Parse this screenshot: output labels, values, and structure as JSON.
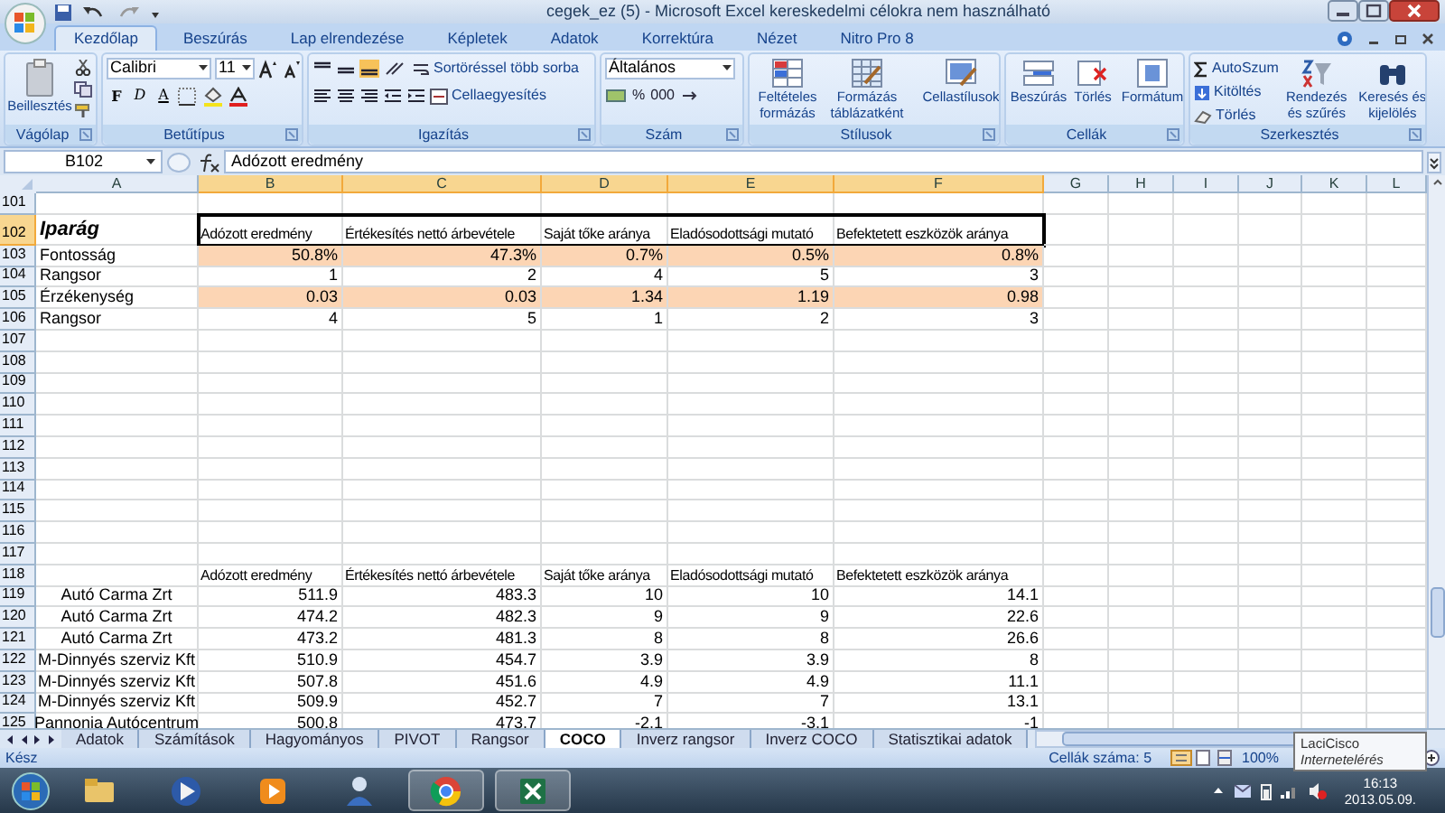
{
  "window": {
    "title": "cegek_ez (5) - Microsoft Excel kereskedelmi célokra nem használható"
  },
  "ribbon": {
    "tabs": [
      {
        "label": "Kezdőlap",
        "selected": true
      },
      {
        "label": "Beszúrás",
        "selected": false
      },
      {
        "label": "Lap elrendezése",
        "selected": false
      },
      {
        "label": "Képletek",
        "selected": false
      },
      {
        "label": "Adatok",
        "selected": false
      },
      {
        "label": "Korrektúra",
        "selected": false
      },
      {
        "label": "Nézet",
        "selected": false
      },
      {
        "label": "Nitro Pro 8",
        "selected": false
      }
    ],
    "groups": [
      {
        "label": "Vágólap",
        "buttons": [
          "Beillesztés"
        ]
      },
      {
        "label": "Betűtípus",
        "font": "Calibri",
        "size": "11",
        "buttons": [
          "F",
          "D",
          "A"
        ]
      },
      {
        "label": "Igazítás",
        "buttons": [
          "Sortöréssel több sorba",
          "Cellaegyesítés"
        ]
      },
      {
        "label": "Szám",
        "format": "Általános",
        "buttons": [
          "%",
          "000"
        ]
      },
      {
        "label": "Stílusok",
        "buttons": [
          "Feltételes formázás",
          "Formázás táblázatként",
          "Cellastílusok"
        ]
      },
      {
        "label": "Cellák",
        "buttons": [
          "Beszúrás",
          "Törlés",
          "Formátum"
        ]
      },
      {
        "label": "Szerkesztés",
        "buttons": [
          "AutoSzum",
          "Kitöltés",
          "Törlés",
          "Rendezés és szűrés",
          "Keresés és kijelölés"
        ]
      }
    ]
  },
  "formula_bar": {
    "name_box": "B102",
    "formula": "Adózott eredmény"
  },
  "columns": [
    {
      "label": "A",
      "selected": false
    },
    {
      "label": "B",
      "selected": true
    },
    {
      "label": "C",
      "selected": true
    },
    {
      "label": "D",
      "selected": true
    },
    {
      "label": "E",
      "selected": true
    },
    {
      "label": "F",
      "selected": true
    },
    {
      "label": "G",
      "selected": false
    },
    {
      "label": "H",
      "selected": false
    },
    {
      "label": "I",
      "selected": false
    },
    {
      "label": "J",
      "selected": false
    },
    {
      "label": "K",
      "selected": false
    },
    {
      "label": "L",
      "selected": false
    }
  ],
  "rows": [
    {
      "number": "101",
      "kind": "empty",
      "selected": false,
      "highlighted": false
    },
    {
      "number": "102",
      "kind": "header",
      "selected": true,
      "highlighted": false,
      "label": "Iparág",
      "cells": [
        "Adózott eredmény",
        "Értékesítés nettó árbevétele",
        "Saját tőke aránya",
        "Eladósodottsági mutató",
        "Befektetett eszközök aránya"
      ]
    },
    {
      "number": "103",
      "kind": "values",
      "selected": false,
      "highlighted": true,
      "label": "Fontosság",
      "cells": [
        "50.8%",
        "47.3%",
        "0.7%",
        "0.5%",
        "0.8%"
      ]
    },
    {
      "number": "104",
      "kind": "values",
      "selected": false,
      "highlighted": false,
      "label": "Rangsor",
      "cells": [
        "1",
        "2",
        "4",
        "5",
        "3"
      ]
    },
    {
      "number": "105",
      "kind": "values",
      "selected": false,
      "highlighted": true,
      "label": "Érzékenység",
      "cells": [
        "0.03",
        "0.03",
        "1.34",
        "1.19",
        "0.98"
      ]
    },
    {
      "number": "106",
      "kind": "values",
      "selected": false,
      "highlighted": false,
      "label": "Rangsor",
      "cells": [
        "4",
        "5",
        "1",
        "2",
        "3"
      ]
    },
    {
      "number": "107",
      "kind": "empty",
      "selected": false,
      "highlighted": false
    },
    {
      "number": "108",
      "kind": "empty",
      "selected": false,
      "highlighted": false
    },
    {
      "number": "109",
      "kind": "empty",
      "selected": false,
      "highlighted": false
    },
    {
      "number": "110",
      "kind": "empty",
      "selected": false,
      "highlighted": false
    },
    {
      "number": "111",
      "kind": "empty",
      "selected": false,
      "highlighted": false
    },
    {
      "number": "112",
      "kind": "empty",
      "selected": false,
      "highlighted": false
    },
    {
      "number": "113",
      "kind": "empty",
      "selected": false,
      "highlighted": false
    },
    {
      "number": "114",
      "kind": "empty",
      "selected": false,
      "highlighted": false
    },
    {
      "number": "115",
      "kind": "empty",
      "selected": false,
      "highlighted": false
    },
    {
      "number": "116",
      "kind": "empty",
      "selected": false,
      "highlighted": false
    },
    {
      "number": "117",
      "kind": "empty",
      "selected": false,
      "highlighted": false
    },
    {
      "number": "118",
      "kind": "header",
      "selected": false,
      "highlighted": false,
      "cells": [
        "Adózott eredmény",
        "Értékesítés nettó árbevétele",
        "Saját tőke aránya",
        "Eladósodottsági mutató",
        "Befektetett eszközök aránya"
      ]
    },
    {
      "number": "119",
      "kind": "entries",
      "selected": false,
      "highlighted": false,
      "label": "Autó Carma Zrt",
      "cells": [
        "511.9",
        "483.3",
        "10",
        "10",
        "14.1"
      ]
    },
    {
      "number": "120",
      "kind": "entries",
      "selected": false,
      "highlighted": false,
      "label": "Autó Carma Zrt",
      "cells": [
        "474.2",
        "482.3",
        "9",
        "9",
        "22.6"
      ]
    },
    {
      "number": "121",
      "kind": "entries",
      "selected": false,
      "highlighted": false,
      "label": "Autó Carma Zrt",
      "cells": [
        "473.2",
        "481.3",
        "8",
        "8",
        "26.6"
      ]
    },
    {
      "number": "122",
      "kind": "entries",
      "selected": false,
      "highlighted": false,
      "label": "M-Dinnyés szerviz Kft",
      "cells": [
        "510.9",
        "454.7",
        "3.9",
        "3.9",
        "8"
      ]
    },
    {
      "number": "123",
      "kind": "entries",
      "selected": false,
      "highlighted": false,
      "label": "M-Dinnyés szerviz Kft",
      "cells": [
        "507.8",
        "451.6",
        "4.9",
        "4.9",
        "11.1"
      ]
    },
    {
      "number": "124",
      "kind": "entries",
      "selected": false,
      "highlighted": false,
      "label": "M-Dinnyés szerviz Kft",
      "cells": [
        "509.9",
        "452.7",
        "7",
        "7",
        "13.1"
      ]
    },
    {
      "number": "125",
      "kind": "entries",
      "selected": false,
      "highlighted": false,
      "label": "Pannonia Autócentrum",
      "cells": [
        "500.8",
        "473.7",
        "-2.1",
        "-3.1",
        "-1"
      ]
    }
  ],
  "sheet_tabs": [
    {
      "label": "Adatok",
      "selected": false
    },
    {
      "label": "Számítások",
      "selected": false
    },
    {
      "label": "Hagyományos",
      "selected": false
    },
    {
      "label": "PIVOT",
      "selected": false
    },
    {
      "label": "Rangsor",
      "selected": false
    },
    {
      "label": "COCO",
      "selected": true
    },
    {
      "label": "Inverz rangsor",
      "selected": false
    },
    {
      "label": "Inverz COCO",
      "selected": false
    },
    {
      "label": "Statisztikai adatok",
      "selected": false
    }
  ],
  "status_bar": {
    "status": "Kész",
    "selection_count": "Cellák száma: 5",
    "zoom": "100%"
  },
  "tooltip": {
    "title": "LaciCisco",
    "subtitle": "Internetelérés"
  },
  "taskbar": {
    "apps": [
      {
        "kind": "folder",
        "running": false
      },
      {
        "kind": "media",
        "running": false
      },
      {
        "kind": "player",
        "running": false
      },
      {
        "kind": "user",
        "running": false
      },
      {
        "kind": "browser",
        "running": true
      },
      {
        "kind": "spreadsheet",
        "running": true
      }
    ],
    "time": "16:13",
    "date": "2013.05.09."
  }
}
